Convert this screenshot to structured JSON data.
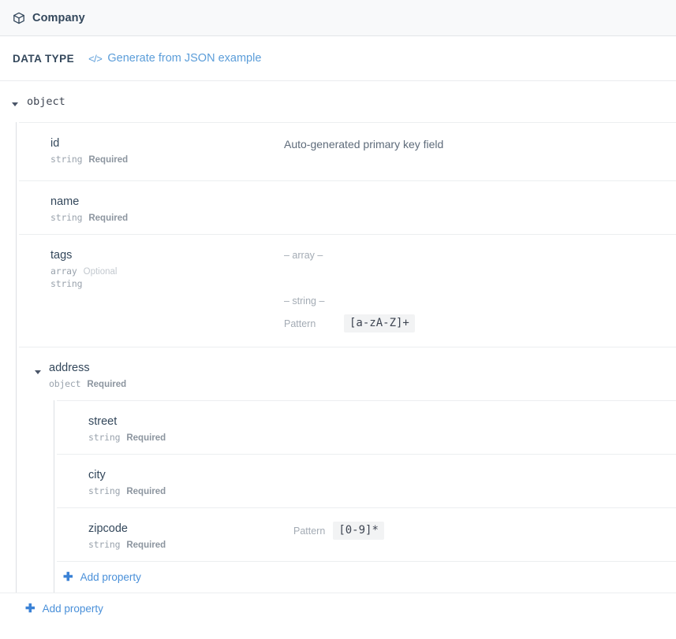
{
  "header": {
    "icon": "cube-icon",
    "title": "Company"
  },
  "datatype_bar": {
    "label": "DATA TYPE",
    "generate_icon": "code-icon",
    "generate_link": "Generate from JSON example"
  },
  "tree": {
    "root": {
      "caret_icon": "caret-down-icon",
      "type": "object"
    },
    "properties": [
      {
        "name": "id",
        "type": "string",
        "requirement": "Required",
        "requirement_style": "required",
        "description": "Auto-generated primary key field"
      },
      {
        "name": "name",
        "type": "string",
        "requirement": "Required",
        "requirement_style": "required",
        "description": ""
      },
      {
        "name": "tags",
        "type": "array",
        "requirement": "Optional",
        "requirement_style": "optional",
        "subtype": "string",
        "array_separator": "– array –",
        "string_separator": "– string –",
        "pattern_label": "Pattern",
        "pattern_value": "[a-zA-Z]+"
      },
      {
        "name": "address",
        "caret_icon": "caret-down-icon",
        "type": "object",
        "requirement": "Required",
        "requirement_style": "required",
        "children": [
          {
            "name": "street",
            "type": "string",
            "requirement": "Required",
            "requirement_style": "required"
          },
          {
            "name": "city",
            "type": "string",
            "requirement": "Required",
            "requirement_style": "required"
          },
          {
            "name": "zipcode",
            "type": "string",
            "requirement": "Required",
            "requirement_style": "required",
            "pattern_label": "Pattern",
            "pattern_value": "[0-9]*"
          }
        ],
        "add_property_label": "Add property"
      }
    ],
    "add_property_label": "Add property"
  },
  "colors": {
    "link": "#4a90d9",
    "title": "#33475b",
    "header_bg": "#f8f9fa",
    "chip_bg": "#f2f3f4"
  }
}
